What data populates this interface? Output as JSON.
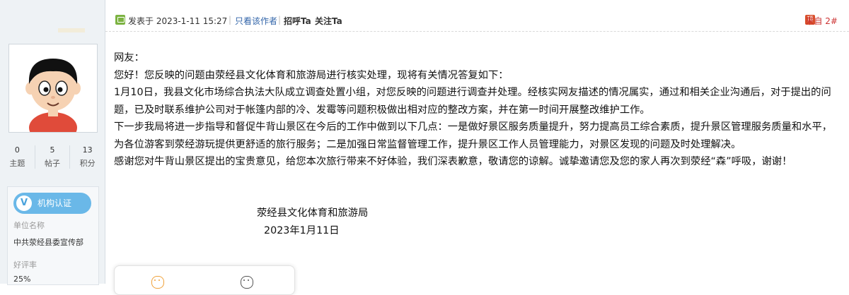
{
  "sidebar": {
    "avatar_alt": "avatar",
    "stats": [
      {
        "num": "0",
        "label": "主题"
      },
      {
        "num": "5",
        "label": "帖子"
      },
      {
        "num": "13",
        "label": "积分"
      }
    ],
    "org_badge": "机构认证",
    "org_unit_label": "单位名称",
    "org_unit_value": "中共荥经县委宣传部",
    "rating_label": "好评率",
    "rating_value": "25%"
  },
  "post_header": {
    "posted_at": "发表于 2023-1-11 15:27",
    "only_author": "只看该作者",
    "greet": "招呼Ta",
    "follow": "关注Ta",
    "floor": "来自 2#",
    "reply_icon": "顶"
  },
  "post_body": {
    "paragraphs": [
      "网友：",
      "您好！您反映的问题由荥经县文化体育和旅游局进行核实处理，现将有关情况答复如下：",
      "1月10日，我县文化市场综合执法大队成立调查处置小组，对您反映的问题进行调查并处理。经核实网友描述的情况属实，通过和相关企业沟通后，对于提出的问题，已及时联系维护公司对于帐篷内部的冷、发霉等问题积极做出相对应的整改方案，并在第一时间开展整改维护工作。",
      "下一步我局将进一步指导和督促牛背山景区在今后的工作中做到以下几点：一是做好景区服务质量提升，努力提高员工综合素质，提升景区管理服务质量和水平，为各位游客到荥经游玩提供更舒适的旅行服务；二是加强日常监督管理工作，提升景区工作人员管理能力，对景区发现的问题及时处理解决。",
      "感谢您对牛背山景区提出的宝贵意见，给您本次旅行带来不好体验，我们深表歉意，敬请您的谅解。诚挚邀请您及您的家人再次到荥经“森”呼吸，谢谢！"
    ],
    "signature_org": "荥经县文化体育和旅游局",
    "signature_date": "2023年1月11日"
  },
  "colors": {
    "sidebar_bg": "#eef2f5",
    "badge_blue": "#6ab8e8",
    "link_blue": "#3366aa",
    "floor_red": "#cc3333",
    "post_icon_green": "#7cb342"
  }
}
